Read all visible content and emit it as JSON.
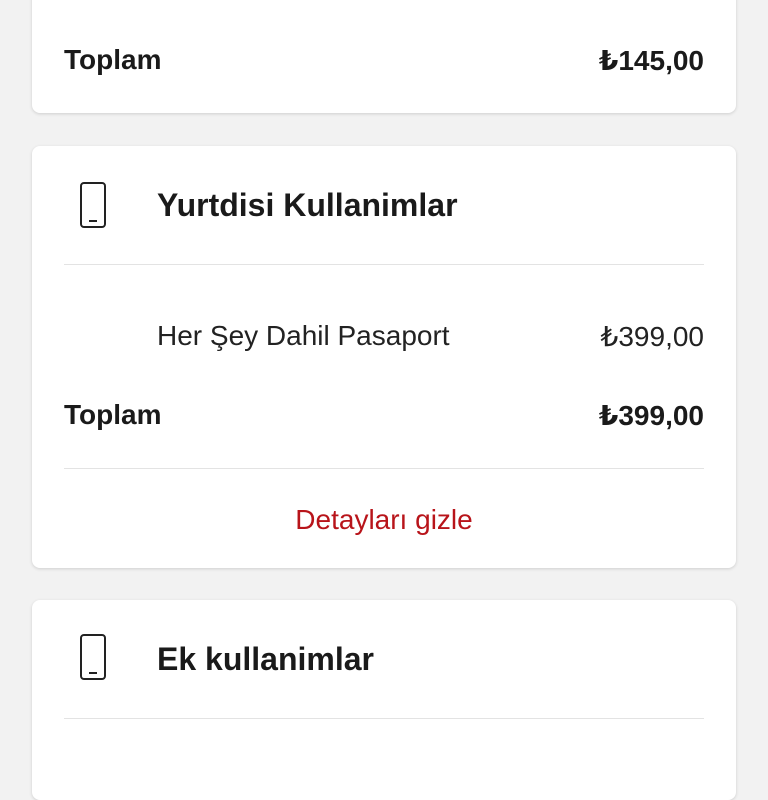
{
  "card_previous": {
    "total_label": "Toplam",
    "total_value": "₺145,00"
  },
  "card_abroad": {
    "icon": "phone-icon",
    "title": "Yurtdisi Kullanimlar",
    "items": [
      {
        "label": "Her Şey Dahil Pasaport",
        "value": "₺399,00"
      }
    ],
    "total_label": "Toplam",
    "total_value": "₺399,00",
    "toggle_label": "Detayları gizle"
  },
  "card_extra": {
    "icon": "phone-icon",
    "title": "Ek kullanimlar"
  },
  "colors": {
    "accent": "#b8141a",
    "background": "#f2f2f2",
    "card": "#ffffff"
  }
}
